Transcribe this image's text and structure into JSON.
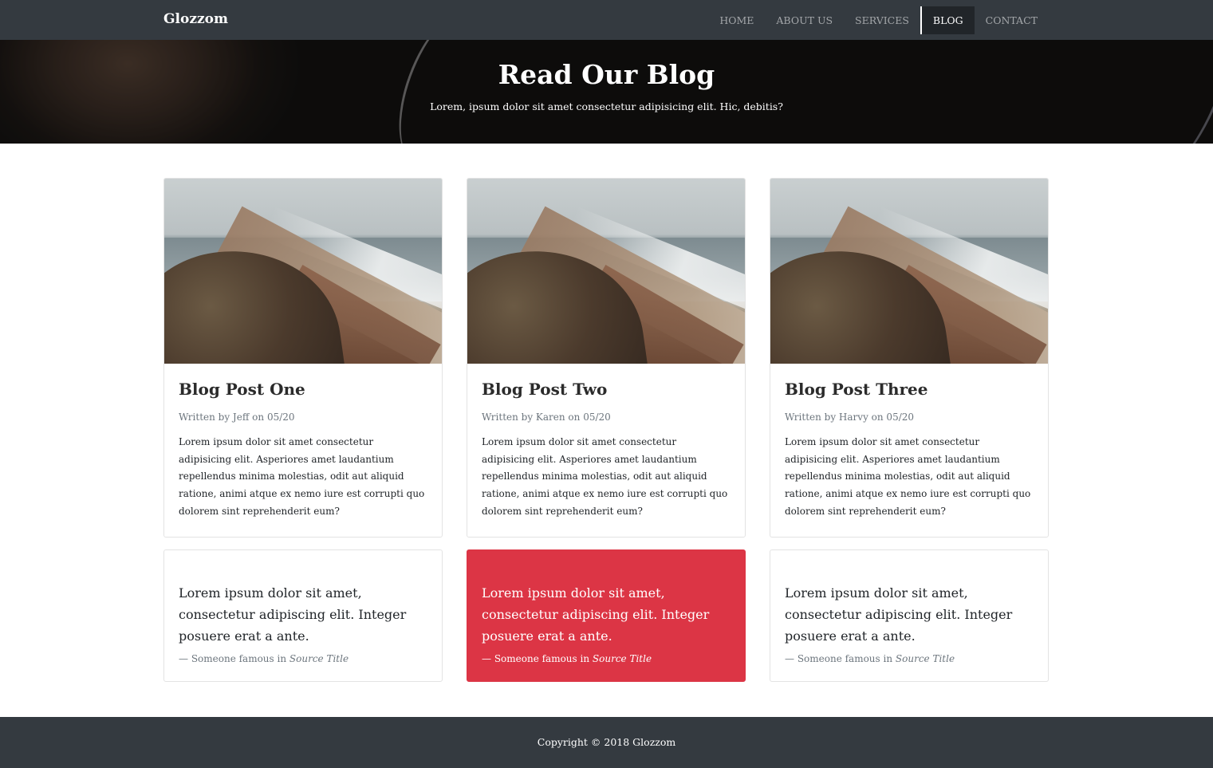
{
  "navbar": {
    "brand": "Glozzom",
    "items": [
      {
        "label": "HOME"
      },
      {
        "label": "ABOUT US"
      },
      {
        "label": "SERVICES"
      },
      {
        "label": "BLOG"
      },
      {
        "label": "CONTACT"
      }
    ],
    "active": "BLOG"
  },
  "hero": {
    "title": "Read Our Blog",
    "subtitle": "Lorem, ipsum dolor sit amet consectetur adipisicing elit. Hic, debitis?"
  },
  "posts": [
    {
      "title": "Blog Post One",
      "meta": "Written by Jeff on 05/20",
      "text": "Lorem ipsum dolor sit amet consectetur adipisicing elit. Asperiores amet laudantium repellendus minima molestias, odit aut aliquid ratione, animi atque ex nemo iure est corrupti quo dolorem sint reprehenderit eum?"
    },
    {
      "title": "Blog Post Two",
      "meta": "Written by Karen on 05/20",
      "text": "Lorem ipsum dolor sit amet consectetur adipisicing elit. Asperiores amet laudantium repellendus minima molestias, odit aut aliquid ratione, animi atque ex nemo iure est corrupti quo dolorem sint reprehenderit eum?"
    },
    {
      "title": "Blog Post Three",
      "meta": "Written by Harvy on 05/20",
      "text": "Lorem ipsum dolor sit amet consectetur adipisicing elit. Asperiores amet laudantium repellendus minima molestias, odit aut aliquid ratione, animi atque ex nemo iure est corrupti quo dolorem sint reprehenderit eum?"
    }
  ],
  "quotes": [
    {
      "text": "Lorem ipsum dolor sit amet, consectetur adipiscing elit. Integer posuere erat a ante.",
      "attribution": "— Someone famous in",
      "source": "Source Title"
    },
    {
      "text": "Lorem ipsum dolor sit amet, consectetur adipiscing elit. Integer posuere erat a ante.",
      "attribution": "— Someone famous in",
      "source": "Source Title"
    },
    {
      "text": "Lorem ipsum dolor sit amet, consectetur adipiscing elit. Integer posuere erat a ante.",
      "attribution": "— Someone famous in",
      "source": "Source Title"
    }
  ],
  "footer": {
    "copyright": "Copyright © 2018 Glozzom"
  },
  "colors": {
    "navbar_bg": "#343a40",
    "active_nav_bg": "#212529",
    "highlight_quote_bg": "#dc3545"
  }
}
